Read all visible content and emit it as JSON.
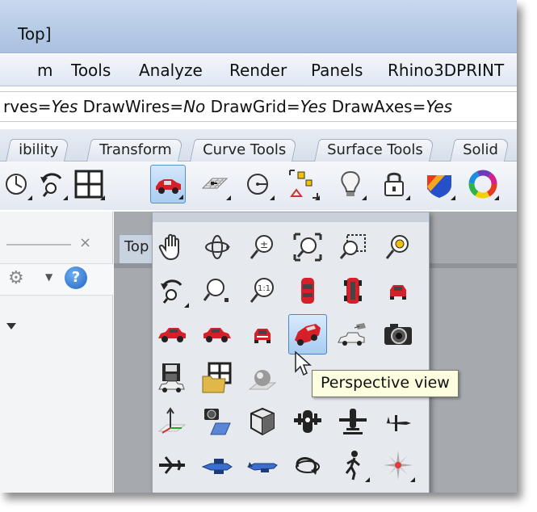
{
  "window": {
    "title": "Top]"
  },
  "menu": {
    "items": [
      "m",
      "Tools",
      "Analyze",
      "Render",
      "Panels",
      "Rhino3DPRINT"
    ]
  },
  "command_line": {
    "segments": [
      {
        "text": "rves=",
        "italic": false
      },
      {
        "text": "Yes",
        "italic": true
      },
      {
        "text": " DrawWires=",
        "italic": false
      },
      {
        "text": "No",
        "italic": true
      },
      {
        "text": " DrawGrid=",
        "italic": false
      },
      {
        "text": "Yes",
        "italic": true
      },
      {
        "text": " DrawAxes=",
        "italic": false
      },
      {
        "text": "Yes",
        "italic": true
      }
    ]
  },
  "tabs": {
    "items": [
      "ibility",
      "Transform",
      "Curve Tools",
      "Surface Tools",
      "Solid"
    ]
  },
  "toolbar": {
    "icons": [
      "gumball-icon",
      "rotate-view-icon",
      "four-viewports-icon",
      "car-view-icon",
      "grid-plane-icon",
      "circle-icon",
      "select-points-icon",
      "light-bulb-icon",
      "lock-icon",
      "render-material-icon",
      "color-wheel-icon"
    ]
  },
  "viewport": {
    "tab_label": "Top"
  },
  "flyout": {
    "rows": [
      [
        "pan-hand-icon",
        "rotate-view-icon",
        "zoom-dynamic-icon",
        "zoom-extents-icon",
        "zoom-window-icon",
        "zoom-selected-icon"
      ],
      [
        "undo-view-change-icon",
        "zoom-target-icon",
        "zoom-1-to-1-icon",
        "top-view-car-icon",
        "bottom-view-car-icon",
        "front-view-car-icon"
      ],
      [
        "left-view-car-icon",
        "right-view-car-icon",
        "back-view-car-icon",
        "perspective-view-icon",
        "two-point-perspective-icon",
        "camera-icon"
      ],
      [
        "save-view-icon",
        "open-view-icon",
        "sphere-icon",
        "",
        "",
        ""
      ],
      [
        "set-cplane-icon",
        "camera-plane-icon",
        "box-view-icon",
        "plane-front-icon",
        "plane-top-icon",
        "plane-side-icon"
      ],
      [
        "plane-left-icon",
        "plane-right-icon",
        "plane-back-icon",
        "orbit-icon",
        "walkabout-icon",
        "compass-icon"
      ]
    ]
  },
  "tooltip": {
    "text": "Perspective view"
  },
  "colors": {
    "accent": "#5d8fc4",
    "car_red": "#d5202a",
    "tooltip_bg": "#fdfde0"
  }
}
